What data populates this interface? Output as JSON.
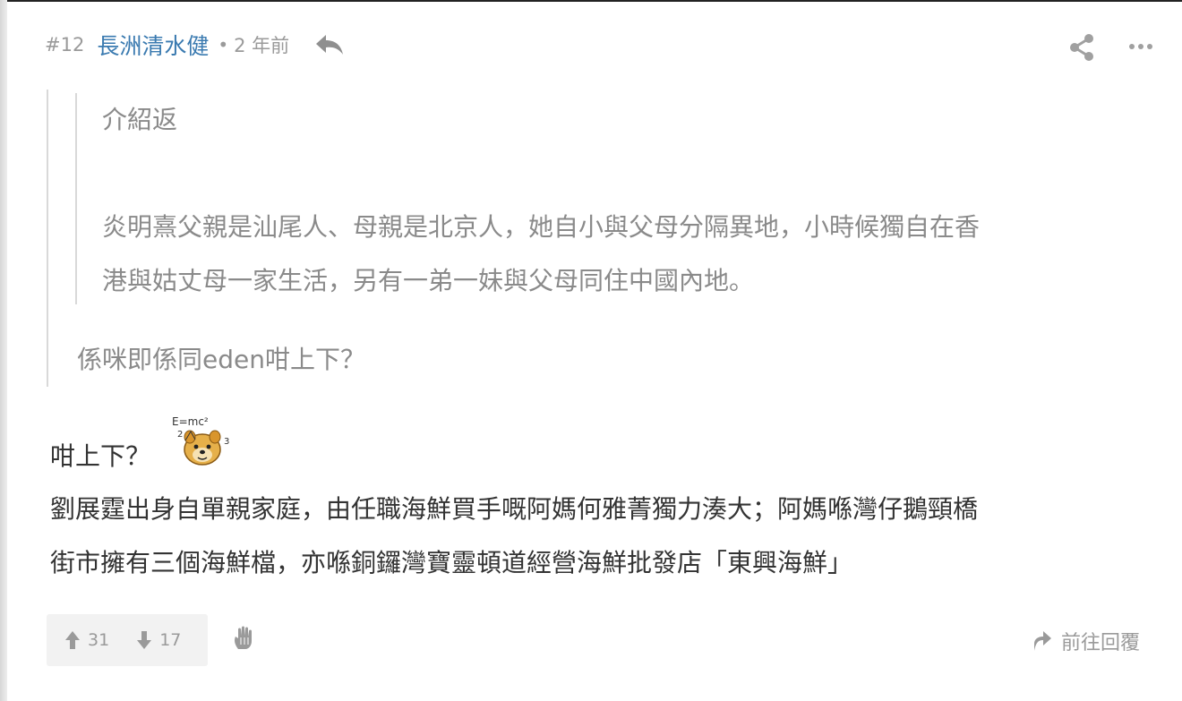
{
  "post": {
    "floor": "#12",
    "author": "長洲清水健",
    "separator": "•",
    "time": "2 年前",
    "quote": {
      "inner_lines": [
        "介紹返",
        "炎明熹父親是汕尾人、母親是北京人，她自小與父母分隔異地，小時候獨自在香",
        "港與姑丈母一家生活，另有一弟一妹與父母同住中國內地。"
      ],
      "outer_line": "係咪即係同eden咁上下？"
    },
    "body": {
      "line1": "咁上下？",
      "line2": "劉展霆出身自單親家庭，由任職海鮮買手嘅阿媽何雅菁獨力湊大；阿媽喺灣仔鵝頸橋",
      "line3": "街市擁有三個海鮮檔，亦喺銅鑼灣寶靈頓道經營海鮮批發店「東興海鮮」"
    },
    "emoji": {
      "name": "einstein-dog-emoji",
      "formula": "E=mc²"
    },
    "footer": {
      "upvotes": "31",
      "downvotes": "17",
      "goto_reply": "前往回覆"
    }
  },
  "colors": {
    "author": "#3a7ab0",
    "muted": "#9a9a9a",
    "quote_text": "#8a8a8a",
    "body_text": "#333333",
    "quote_border": "#d9d9d9",
    "vote_bg": "#f2f2f2"
  },
  "icons": [
    "reply-icon",
    "share-icon",
    "more-icon",
    "upvote-icon",
    "downvote-icon",
    "hand-icon",
    "forward-icon"
  ]
}
